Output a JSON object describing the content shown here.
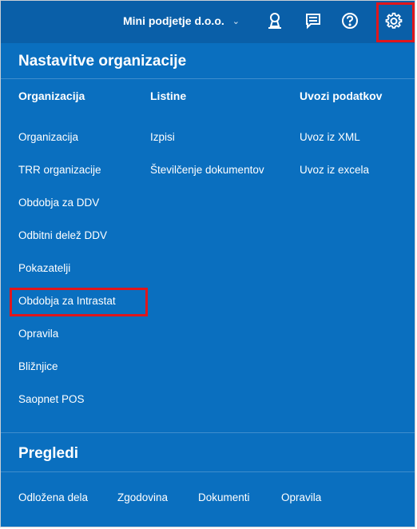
{
  "header": {
    "company": "Mini podjetje d.o.o.",
    "icons": [
      "user-icon",
      "messages-icon",
      "help-icon",
      "settings-icon"
    ]
  },
  "settings_section": {
    "title": "Nastavitve organizacije",
    "columns": [
      {
        "heading": "Organizacija",
        "items": [
          "Organizacija",
          "TRR organizacije",
          "Obdobja za DDV",
          "Odbitni delež DDV",
          "Pokazatelji",
          "Obdobja za Intrastat",
          "Opravila",
          "Bližnjice",
          "Saopnet POS"
        ]
      },
      {
        "heading": "Listine",
        "items": [
          "Izpisi",
          "Številčenje dokumentov"
        ]
      },
      {
        "heading": "Uvozi podatkov",
        "items": [
          "Uvoz iz XML",
          "Uvoz iz excela"
        ]
      }
    ]
  },
  "overview_section": {
    "title": "Pregledi",
    "items": [
      "Odložena dela",
      "Zgodovina",
      "Dokumenti",
      "Opravila"
    ]
  },
  "colors": {
    "panel": "#0a6fbf",
    "topbar": "#0a5fa8",
    "highlight": "#e0161c"
  }
}
